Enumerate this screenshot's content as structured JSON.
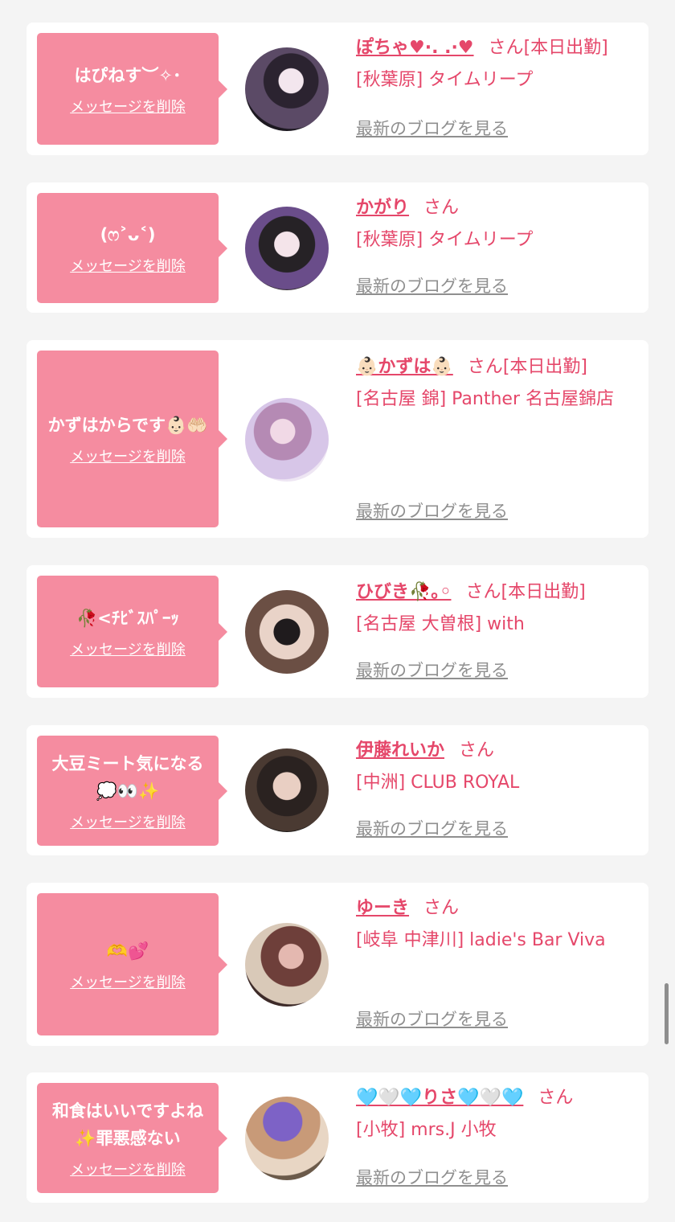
{
  "delete_label": "メッセージを削除",
  "blog_label": "最新のブログを見る",
  "san_label": "さん",
  "theme": {
    "accent": "#e5476a",
    "bubble": "#f58ca0",
    "link_gray": "#8f8f8f"
  },
  "cards": [
    {
      "message": "はぴねす︶✧･",
      "name": "ぽちゃ♥︎·. .·♥︎",
      "status": "[本日出勤]",
      "shop": "[秋葉原] タイムリープ"
    },
    {
      "message": "(ෆ˃ᴗ˂)",
      "name": "かがり",
      "status": "",
      "shop": "[秋葉原] タイムリープ"
    },
    {
      "message": "かずはからです👶🏻🤲🏻",
      "name": "👶🏻かずは👶🏻",
      "status": "[本日出勤]",
      "shop": "[名古屋 錦] Panther 名古屋錦店"
    },
    {
      "message": "🥀<ﾁﾋﾞｽﾊﾟｰｯ",
      "name": "ひびき🥀｡◦",
      "status": "[本日出勤]",
      "shop": "[名古屋 大曽根] with"
    },
    {
      "message": "大豆ミート気になる💭👀✨",
      "name": "伊藤れいか",
      "status": "",
      "shop": "[中洲] CLUB ROYAL"
    },
    {
      "message": "🫶💕",
      "name": "ゆーき",
      "status": "",
      "shop": "[岐阜 中津川] ladie's Bar Viva"
    },
    {
      "message": "和食はいいですよね✨罪悪感ない",
      "name": "🩵🤍🩵りさ🩵🤍🩵",
      "status": "",
      "shop": "[小牧] mrs.J 小牧"
    }
  ]
}
